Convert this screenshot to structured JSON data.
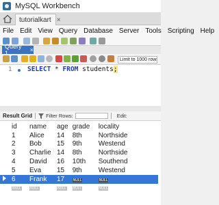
{
  "app": {
    "title": "MySQL Workbench"
  },
  "tabs": {
    "connection": "tutorialkart",
    "close_glyph": "×"
  },
  "menu": [
    "File",
    "Edit",
    "View",
    "Query",
    "Database",
    "Server",
    "Tools",
    "Scripting",
    "Help"
  ],
  "query_tab": {
    "label": "Query 1",
    "close_glyph": "×"
  },
  "toolbar": {
    "limit": "Limit to 1000 rows"
  },
  "editor": {
    "line_number": "1",
    "sql": {
      "select": "SELECT",
      "star": " * ",
      "from": "FROM",
      "table": " students",
      "semicolon": ";"
    }
  },
  "result_toolbar": {
    "label": "Result Grid",
    "filter_label": "Filter Rows:",
    "edit_label": "Edit:"
  },
  "grid": {
    "columns": [
      "id",
      "name",
      "age",
      "grade",
      "locality"
    ],
    "rows": [
      [
        "1",
        "Alice",
        "14",
        "8th",
        "Northside"
      ],
      [
        "2",
        "Bob",
        "15",
        "9th",
        "Westend"
      ],
      [
        "3",
        "Charlie",
        "14",
        "8th",
        "Northside"
      ],
      [
        "4",
        "David",
        "16",
        "10th",
        "Southend"
      ],
      [
        "5",
        "Eva",
        "15",
        "9th",
        "Westend"
      ],
      [
        "6",
        "Frank",
        "17",
        "NULL",
        "NULL"
      ]
    ],
    "null_row": [
      "NULL",
      "NULL",
      "NULL",
      "NULL",
      "NULL"
    ],
    "selected_row": 5
  },
  "colors": {
    "accent": "#3477d6",
    "keyword": "#1b3db8",
    "query_tab": "#3a73c4"
  }
}
